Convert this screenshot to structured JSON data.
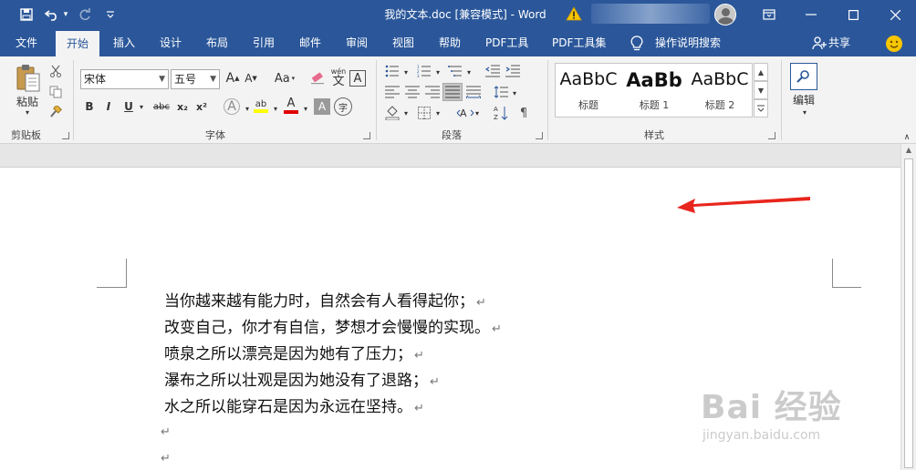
{
  "title_bar": {
    "quick_access": [
      {
        "name": "save-icon",
        "glyph": "💾"
      },
      {
        "name": "undo-icon",
        "glyph": "↶"
      },
      {
        "name": "undo-dropdown-icon",
        "glyph": "▾"
      },
      {
        "name": "redo-icon",
        "glyph": "↻"
      },
      {
        "name": "customize-qat-icon",
        "glyph": "▾"
      }
    ],
    "title": "我的文本.doc [兼容模式]  -  Word",
    "window_buttons": {
      "ribbon_display": "⊡",
      "minimize": "—",
      "maximize": "☐",
      "close": "✕"
    }
  },
  "tabs": [
    {
      "label": "文件",
      "active": false
    },
    {
      "label": "开始",
      "active": true
    },
    {
      "label": "插入",
      "active": false
    },
    {
      "label": "设计",
      "active": false
    },
    {
      "label": "布局",
      "active": false
    },
    {
      "label": "引用",
      "active": false
    },
    {
      "label": "邮件",
      "active": false
    },
    {
      "label": "审阅",
      "active": false
    },
    {
      "label": "视图",
      "active": false
    },
    {
      "label": "帮助",
      "active": false
    },
    {
      "label": "PDF工具",
      "active": false
    },
    {
      "label": "PDF工具集",
      "active": false
    }
  ],
  "tell_me": "操作说明搜索",
  "share": "共享",
  "ribbon": {
    "clipboard": {
      "paste": "粘贴",
      "label": "剪贴板"
    },
    "font": {
      "font_name": "宋体",
      "font_size": "五号",
      "grow": "A",
      "shrink": "A",
      "case": "Aa",
      "phonetic": "wén",
      "phonetic_char": "文",
      "border_char": "A",
      "bold": "B",
      "italic": "I",
      "underline": "U",
      "strikethrough": "abc",
      "subscript": "x₂",
      "superscript": "x²",
      "text_effects": "A",
      "highlight": "ab",
      "font_color": "A",
      "shading": "A",
      "enclose": "字",
      "label": "字体"
    },
    "paragraph": {
      "label": "段落"
    },
    "styles": {
      "items": [
        {
          "sample": "AaBbC",
          "name": "标题"
        },
        {
          "sample": "AaBb",
          "name": "标题 1"
        },
        {
          "sample": "AaBbC",
          "name": "标题 2"
        }
      ],
      "label": "样式"
    },
    "editing": {
      "label": "编辑"
    }
  },
  "document": {
    "lines": [
      "当你越来越有能力时，自然会有人看得起你；",
      "改变自己，你才有自信，梦想才会慢慢的实现。",
      "喷泉之所以漂亮是因为她有了压力；",
      "瀑布之所以壮观是因为她没有了退路；",
      "水之所以能穿石是因为永远在坚持。"
    ],
    "paragraph_mark": "↵"
  },
  "watermark": {
    "main": "Bai 经验",
    "sub": "jingyan.baidu.com"
  },
  "colors": {
    "title_bar": "#2b579a",
    "ribbon": "#f3f3f3",
    "arrow": "#e8261d",
    "highlight_bar": "#ffff00",
    "font_color_bar": "#e00000"
  }
}
